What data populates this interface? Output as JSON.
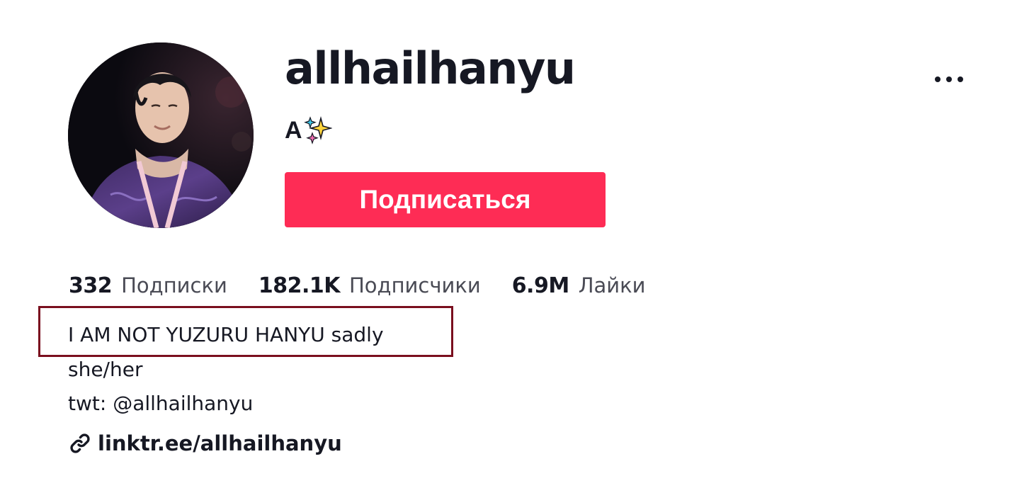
{
  "profile": {
    "username": "allhailhanyu",
    "nickname": "A",
    "nickname_emoji": "sparkles-icon",
    "follow_label": "Подписаться"
  },
  "stats": [
    {
      "value": "332",
      "label": "Подписки"
    },
    {
      "value": "182.1K",
      "label": "Подписчики"
    },
    {
      "value": "6.9M",
      "label": "Лайки"
    }
  ],
  "bio": {
    "line1": "I AM NOT YUZURU HANYU sadly",
    "line2": "she/her",
    "line3": "twt: @allhailhanyu"
  },
  "link": {
    "text": "linktr.ee/allhailhanyu",
    "icon": "link-icon"
  },
  "colors": {
    "accent": "#fe2c55",
    "text": "#161823",
    "secondary_text": "#4a4b55",
    "highlight_border": "#7a0f1e"
  }
}
